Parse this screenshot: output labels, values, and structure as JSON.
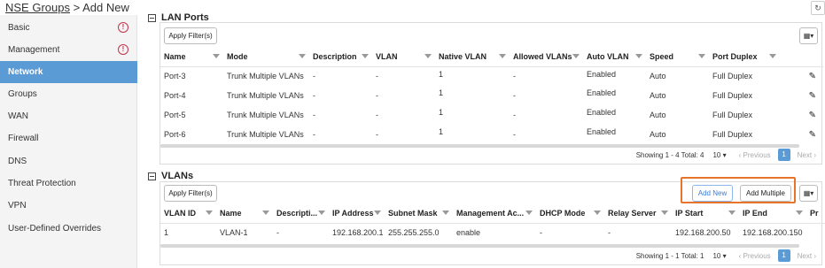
{
  "header": {
    "breadcrumb_link": "NSE Groups",
    "breadcrumb_rest": " > Add New",
    "refresh_icon": "refresh-icon"
  },
  "sidebar": {
    "items": [
      {
        "label": "Basic",
        "warning": true
      },
      {
        "label": "Management",
        "warning": true
      },
      {
        "label": "Network",
        "active": true
      },
      {
        "label": "Groups"
      },
      {
        "label": "WAN"
      },
      {
        "label": "Firewall"
      },
      {
        "label": "DNS"
      },
      {
        "label": "Threat Protection"
      },
      {
        "label": "VPN"
      },
      {
        "label": "User-Defined Overrides"
      }
    ]
  },
  "lan": {
    "title": "LAN Ports",
    "apply_filter": "Apply Filter(s)",
    "columns": [
      "Name",
      "Mode",
      "Description",
      "VLAN",
      "Native VLAN",
      "Allowed VLANs",
      "Auto VLAN",
      "Speed",
      "Port Duplex"
    ],
    "rows": [
      [
        "Port-3",
        "Trunk Multiple VLANs",
        "-",
        "-",
        "1",
        "-",
        "Enabled",
        "Auto",
        "Full Duplex"
      ],
      [
        "Port-4",
        "Trunk Multiple VLANs",
        "-",
        "-",
        "1",
        "-",
        "Enabled",
        "Auto",
        "Full Duplex"
      ],
      [
        "Port-5",
        "Trunk Multiple VLANs",
        "-",
        "-",
        "1",
        "-",
        "Enabled",
        "Auto",
        "Full Duplex"
      ],
      [
        "Port-6",
        "Trunk Multiple VLANs",
        "-",
        "-",
        "1",
        "-",
        "Enabled",
        "Auto",
        "Full Duplex"
      ]
    ],
    "pager": {
      "showing": "Showing 1 - 4 Total: 4",
      "page_size": "10",
      "previous": "Previous",
      "page": "1",
      "next": "Next"
    }
  },
  "vlans": {
    "title": "VLANs",
    "apply_filter": "Apply Filter(s)",
    "add_new": "Add New",
    "add_multiple": "Add Multiple",
    "columns": [
      "VLAN ID",
      "Name",
      "Descripti...",
      "IP Address",
      "Subnet Mask",
      "Management Ac...",
      "DHCP Mode",
      "Relay Server",
      "IP Start",
      "IP End",
      "Pr"
    ],
    "rows": [
      [
        "1",
        "VLAN-1",
        "-",
        "192.168.200.1",
        "255.255.255.0",
        "enable",
        "-",
        "-",
        "192.168.200.50",
        "192.168.200.150",
        ""
      ]
    ],
    "pager": {
      "showing": "Showing 1 - 1 Total: 1",
      "page_size": "10",
      "previous": "Previous",
      "page": "1",
      "next": "Next"
    }
  },
  "colors": {
    "accent": "#5b9bd5",
    "warning": "#c0334d",
    "highlight": "#e8742a"
  }
}
